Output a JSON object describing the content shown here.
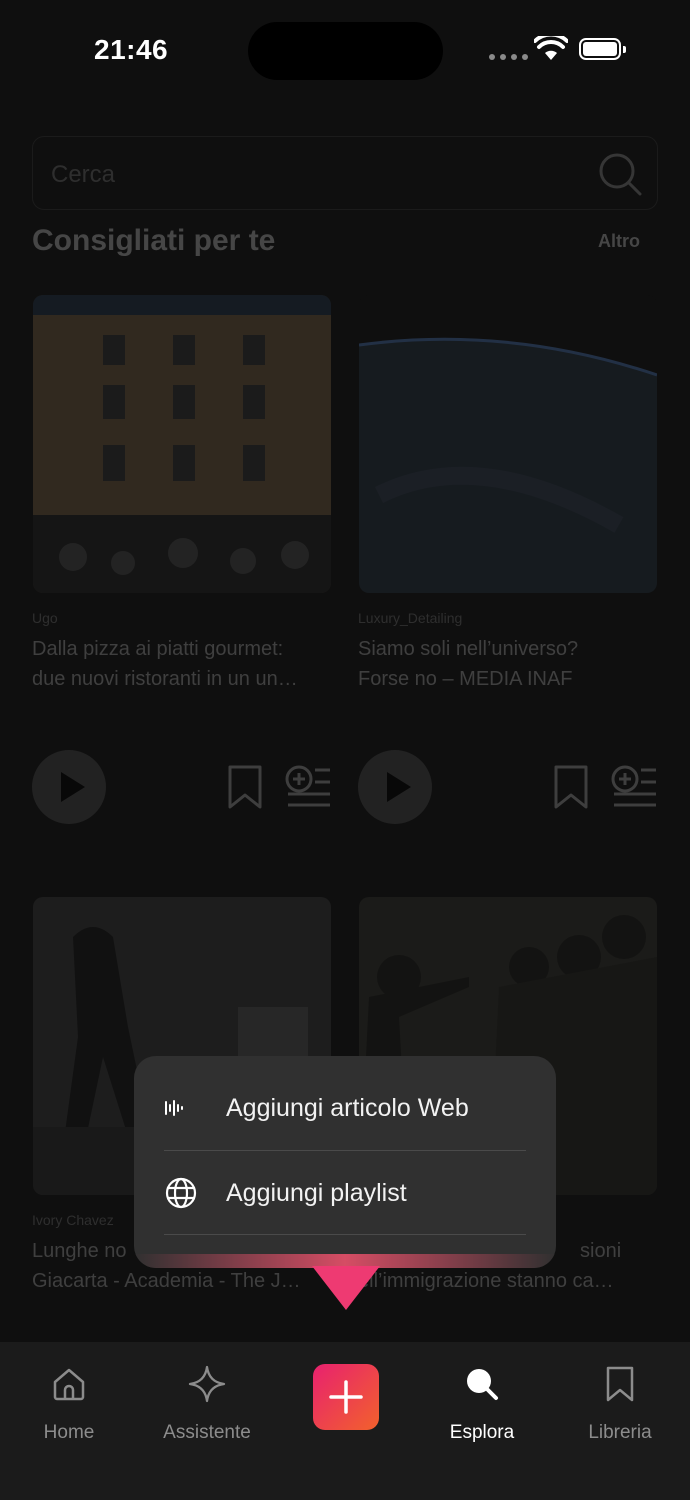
{
  "status_bar": {
    "time": "21:46"
  },
  "search": {
    "placeholder": "Cerca"
  },
  "section": {
    "title": "Consigliati per te",
    "more_label": "Altro"
  },
  "cards": [
    {
      "source": "Ugo",
      "title_line1": "Dalla pizza ai piatti gourmet:",
      "title_line2": "due nuovi ristoranti in un un…"
    },
    {
      "source": "Luxury_Detailing",
      "title_line1": "Siamo soli nell’universo?",
      "title_line2": "Forse no – MEDIA INAF"
    },
    {
      "source": "Ivory Chavez",
      "title_line1": "Lunghe no",
      "title_line2": "Giacarta - Academia - The J…"
    },
    {
      "source": "",
      "title_line1": "sioni",
      "title_line2": "ell’immigrazione stanno ca…"
    }
  ],
  "menu": {
    "items": [
      {
        "label": "Aggiungi articolo Web",
        "icon": "waveform-icon"
      },
      {
        "label": "Aggiungi playlist",
        "icon": "globe-icon"
      }
    ]
  },
  "tabbar": {
    "items": [
      {
        "label": "Home",
        "icon": "home-icon",
        "active": false
      },
      {
        "label": "Assistente",
        "icon": "sparkle-icon",
        "active": false
      },
      {
        "label": "",
        "icon": "plus-icon",
        "active": false
      },
      {
        "label": "Esplora",
        "icon": "search-icon",
        "active": true
      },
      {
        "label": "Libreria",
        "icon": "bookmark-icon",
        "active": false
      }
    ]
  },
  "colors": {
    "accent_start": "#e8216f",
    "accent_end": "#f2612c",
    "background": "#0f0f0f"
  }
}
